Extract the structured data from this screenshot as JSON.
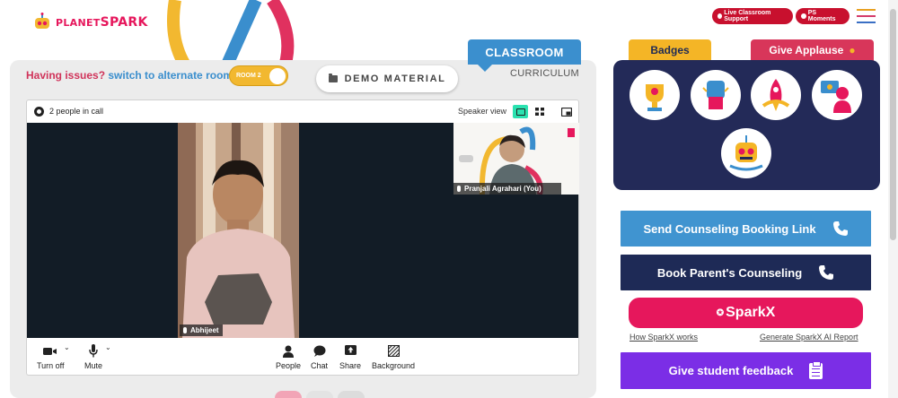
{
  "brand": {
    "name_planet": "PLANET",
    "name_spark": "SPARK"
  },
  "header": {
    "live_support": "Live Classroom Support",
    "ps_moments": "PS Moments"
  },
  "classroom": {
    "tab_classroom": "CLASSROOM",
    "tab_curriculum": "CURRICULUM",
    "issues_q": "Having issues?",
    "issues_switch": "switch to alternate room",
    "room_toggle": "ROOM 2",
    "demo_material": "DEMO MATERIAL"
  },
  "call": {
    "people_count": "2 people in call",
    "speaker_view": "Speaker view",
    "main_participant": "Abhijeet",
    "self_participant": "Pranjali Agrahari (You)",
    "controls": {
      "camera": "Turn off",
      "mic": "Mute",
      "people": "People",
      "chat": "Chat",
      "share": "Share",
      "background": "Background"
    }
  },
  "right": {
    "badges_tab": "Badges",
    "applause_tab": "Give Applause",
    "badges": [
      "trophy-badge",
      "fist-badge",
      "rocket-badge",
      "teacher-badge",
      "robot-badge"
    ],
    "send_counseling": "Send Counseling Booking Link",
    "book_counseling": "Book Parent's Counseling",
    "sparkx": "SparkX",
    "how_sparkx": "How SparkX works",
    "generate_report": "Generate SparkX AI Report",
    "feedback": "Give student feedback"
  },
  "colors": {
    "brand_pink": "#e6175c",
    "classroom_blue": "#3b8fce",
    "navy": "#232a58",
    "badge_yellow": "#f4b526",
    "counseling_blue": "#4094d0",
    "counseling_navy": "#1e2a56",
    "feedback_purple": "#7b2ee6",
    "speaker_view_active": "#2ae2b0"
  }
}
